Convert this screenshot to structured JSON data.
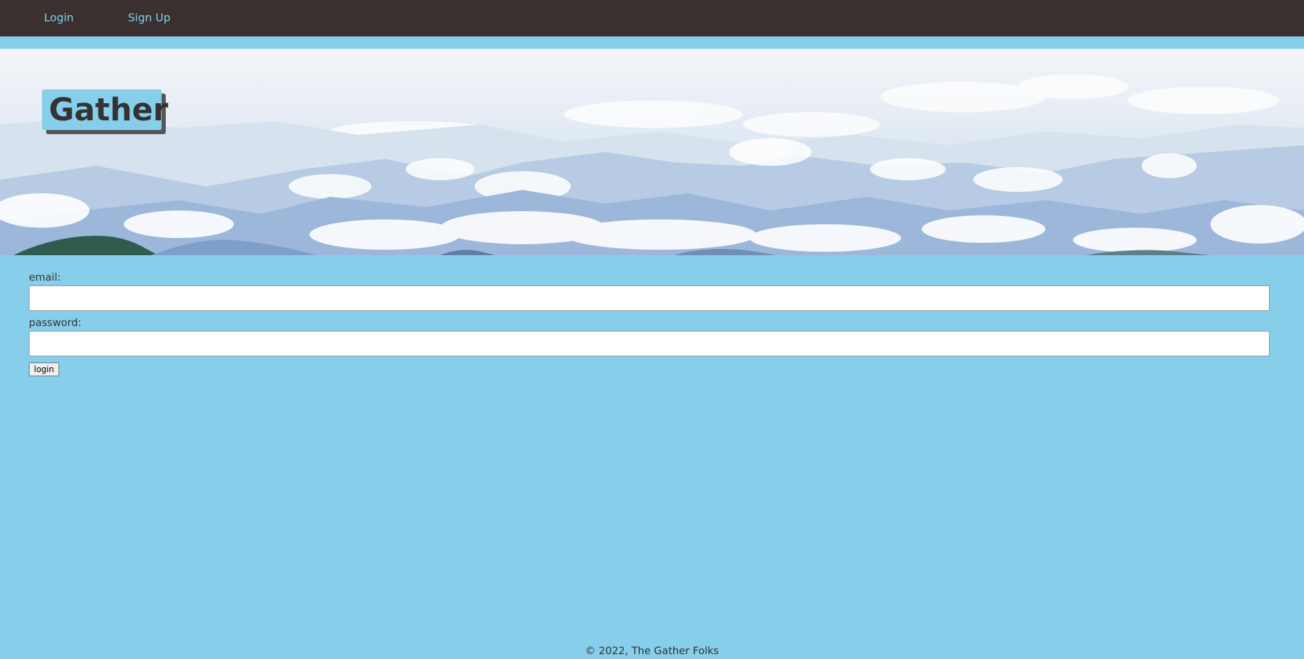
{
  "nav": {
    "login_label": "Login",
    "signup_label": "Sign Up"
  },
  "hero": {
    "brand_title": "Gather"
  },
  "form": {
    "email_label": "email:",
    "email_value": "",
    "password_label": "password:",
    "password_value": "",
    "submit_label": "login"
  },
  "footer": {
    "text": "© 2022, The Gather Folks"
  },
  "colors": {
    "nav_bg": "#3a3030",
    "nav_link": "#87ceeb",
    "page_bg": "#87ceeb",
    "brand_bg": "#87ceeb",
    "text": "#333333"
  }
}
